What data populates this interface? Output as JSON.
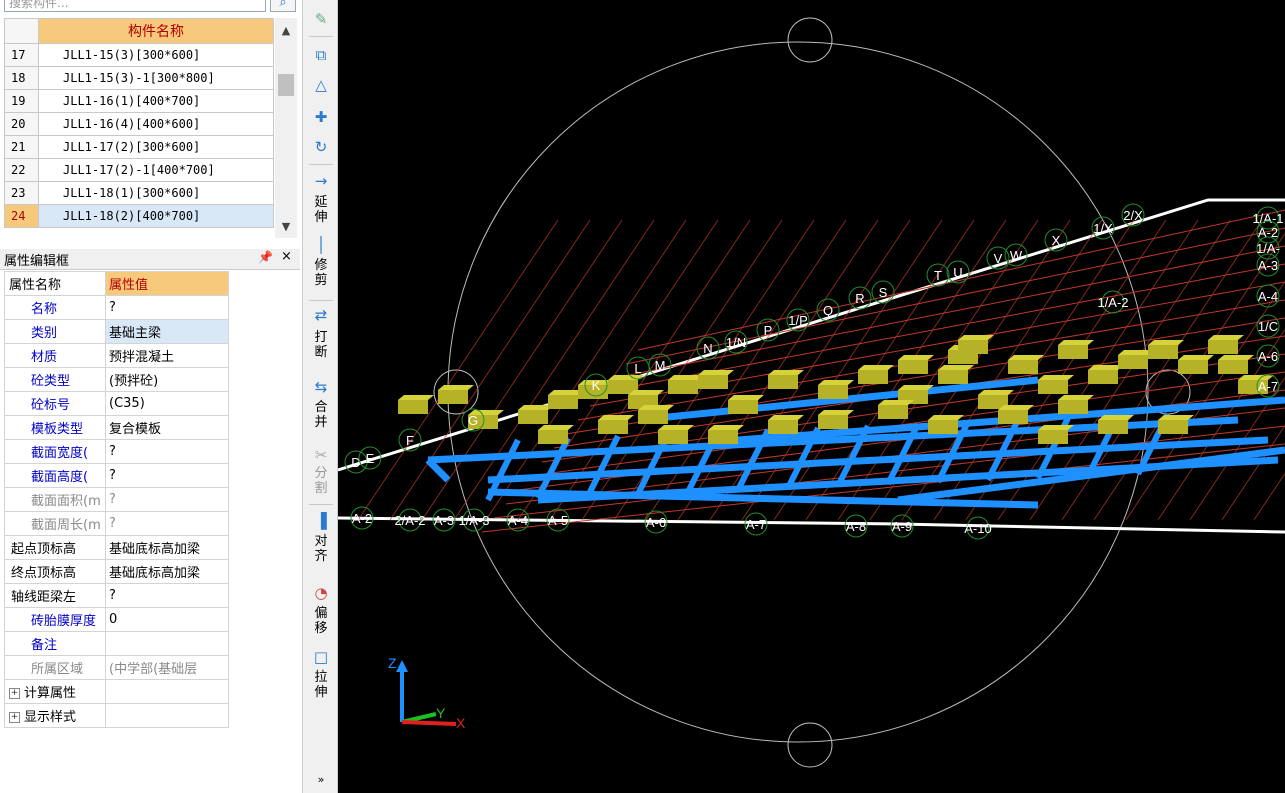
{
  "search": {
    "placeholder": "搜索构件..."
  },
  "component_table": {
    "header": "构件名称",
    "rows": [
      {
        "num": "17",
        "name": "JLL1-15(3)[300*600]"
      },
      {
        "num": "18",
        "name": "JLL1-15(3)-1[300*800]"
      },
      {
        "num": "19",
        "name": "JLL1-16(1)[400*700]"
      },
      {
        "num": "20",
        "name": "JLL1-16(4)[400*600]"
      },
      {
        "num": "21",
        "name": "JLL1-17(2)[300*600]"
      },
      {
        "num": "22",
        "name": "JLL1-17(2)-1[400*700]"
      },
      {
        "num": "23",
        "name": "JLL1-18(1)[300*600]"
      },
      {
        "num": "24",
        "name": "JLL1-18(2)[400*700]"
      }
    ],
    "selected_num": "24"
  },
  "property_panel": {
    "title": "属性编辑框",
    "pin": "ㄗ",
    "close": "×",
    "col_name": "属性名称",
    "col_value": "属性值",
    "rows": [
      {
        "name": "名称",
        "value": "?"
      },
      {
        "name": "类别",
        "value": "基础主梁"
      },
      {
        "name": "材质",
        "value": "预拌混凝土"
      },
      {
        "name": "砼类型",
        "value": "(预拌砼)"
      },
      {
        "name": "砼标号",
        "value": "(C35)"
      },
      {
        "name": "模板类型",
        "value": "复合模板"
      },
      {
        "name": "截面宽度(",
        "value": "?"
      },
      {
        "name": "截面高度(",
        "value": "?"
      },
      {
        "name": "截面面积(m",
        "value": "?"
      },
      {
        "name": "截面周长(m",
        "value": "?"
      },
      {
        "name": "起点顶标高",
        "value": "基础底标高加梁"
      },
      {
        "name": "终点顶标高",
        "value": "基础底标高加梁"
      },
      {
        "name": "轴线距梁左",
        "value": "?"
      },
      {
        "name": "砖胎膜厚度",
        "value": "0"
      },
      {
        "name": "备注",
        "value": ""
      },
      {
        "name": "所属区域",
        "value": "(中学部(基础层"
      }
    ],
    "groups": [
      {
        "name": "计算属性"
      },
      {
        "name": "显示样式"
      }
    ]
  },
  "toolbar": {
    "extend": "延伸",
    "trim": "修剪",
    "break": "打断",
    "merge": "合并",
    "split": "分割",
    "align": "对齐",
    "offset": "偏移",
    "stretch": "拉伸",
    "more": "»"
  },
  "viewport": {
    "axis_labels_top": [
      "1/A-1",
      "A-2",
      "1/A-",
      "A-3",
      "A-4",
      "1/C",
      "A-6",
      "A-7"
    ],
    "axis_labels_bottom": [
      "A-2",
      "2/A-2",
      "A-3",
      "1/A-3",
      "A-4",
      "A-5",
      "A-6",
      "A-7",
      "A-8",
      "A-9",
      "A-10"
    ],
    "axis_labels_grid": [
      "D",
      "E",
      "F",
      "G",
      "K",
      "L",
      "M",
      "N",
      "1/N",
      "P",
      "1/P",
      "Q",
      "R",
      "S",
      "T",
      "U",
      "V",
      "W",
      "X",
      "1/X",
      "2/X",
      "1/A-2"
    ],
    "axis_z": "Z",
    "axis_y": "Y",
    "axis_x": "X",
    "colors": {
      "beam_blue": "#1e90ff",
      "block_yellow": "#b5b228",
      "grid_red": "#c0392b",
      "bubble_green": "#1f8f2a"
    }
  }
}
